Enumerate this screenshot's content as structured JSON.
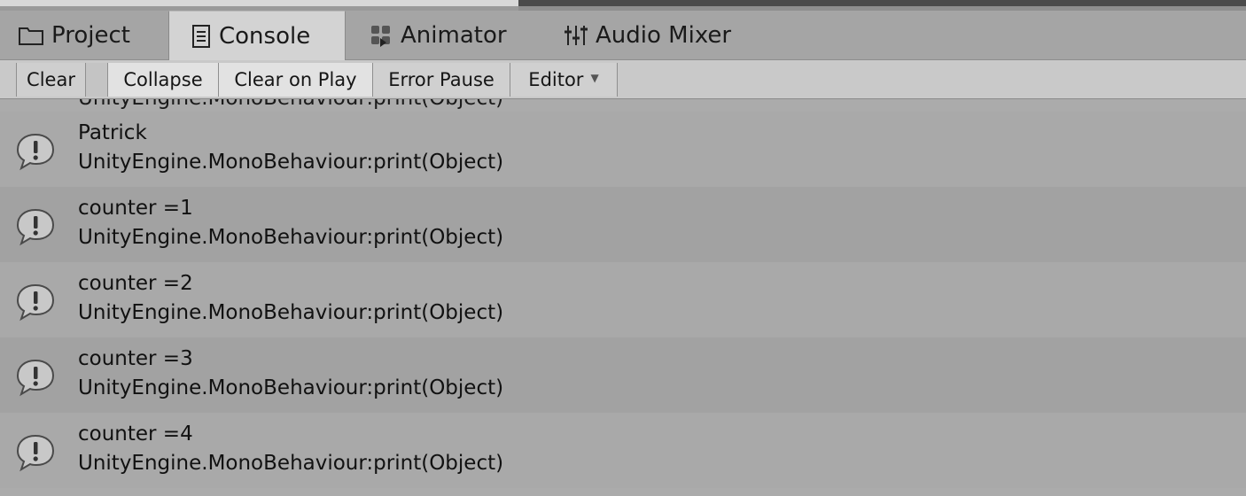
{
  "tabs": [
    {
      "label": "Project",
      "icon": "folder-icon"
    },
    {
      "label": "Console",
      "icon": "console-icon"
    },
    {
      "label": "Animator",
      "icon": "animator-icon"
    },
    {
      "label": "Audio Mixer",
      "icon": "audio-mixer-icon"
    }
  ],
  "toolbar": {
    "clear": "Clear",
    "collapse": "Collapse",
    "clear_on_play": "Clear on Play",
    "error_pause": "Error Pause",
    "editor": "Editor"
  },
  "logs": [
    {
      "message": "Patrick",
      "trace": "UnityEngine.MonoBehaviour:print(Object)",
      "icon": "info-message-icon"
    },
    {
      "message": "counter =1",
      "trace": "UnityEngine.MonoBehaviour:print(Object)",
      "icon": "info-message-icon"
    },
    {
      "message": "counter =2",
      "trace": "UnityEngine.MonoBehaviour:print(Object)",
      "icon": "info-message-icon"
    },
    {
      "message": "counter =3",
      "trace": "UnityEngine.MonoBehaviour:print(Object)",
      "icon": "info-message-icon"
    },
    {
      "message": "counter =4",
      "trace": "UnityEngine.MonoBehaviour:print(Object)",
      "icon": "info-message-icon"
    }
  ],
  "colors": {
    "panel_background": "#a9a9a9",
    "active_tab": "#d3d3d3",
    "toolbar": "#c9c9c9",
    "text": "#111111"
  }
}
